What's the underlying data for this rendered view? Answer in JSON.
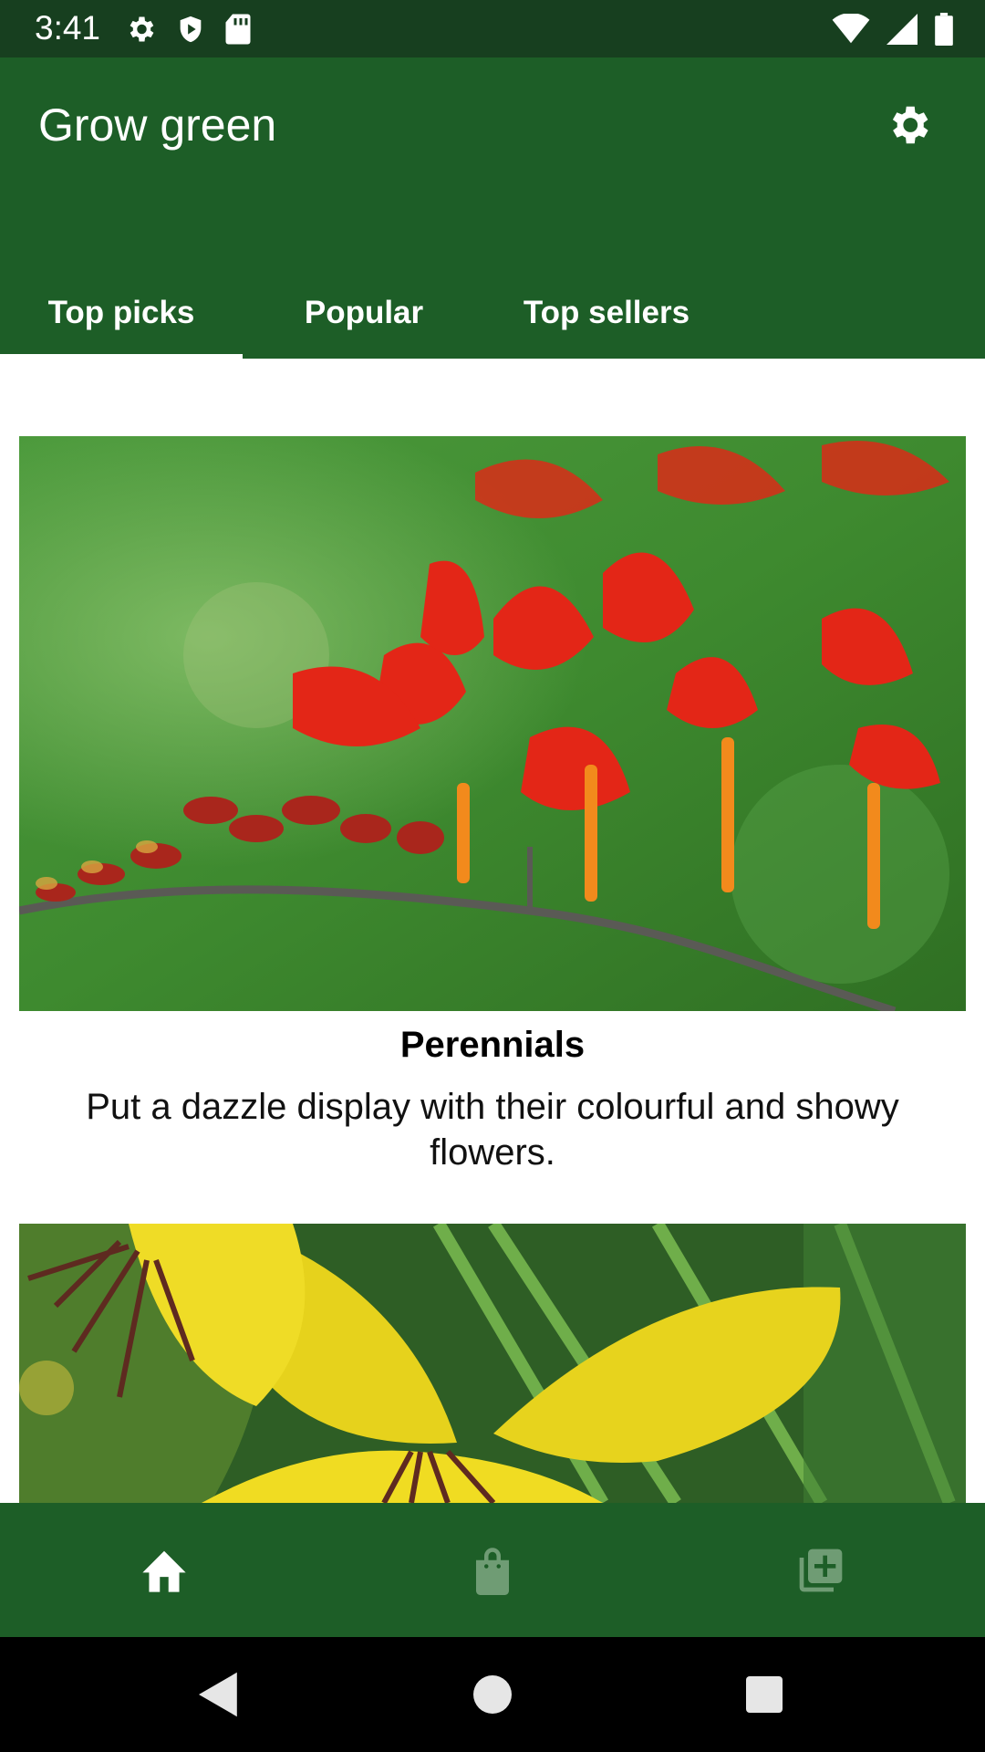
{
  "status_bar": {
    "time": "3:41",
    "left_icons": [
      "settings-icon",
      "play-protect-icon",
      "sd-card-icon"
    ],
    "right_icons": [
      "wifi-icon",
      "signal-icon",
      "battery-icon"
    ]
  },
  "app_bar": {
    "title": "Grow green",
    "settings_icon": "gear-icon",
    "background_color": "#1d5e27"
  },
  "tabs": [
    {
      "label": "Top picks",
      "selected": true
    },
    {
      "label": "Popular",
      "selected": false
    },
    {
      "label": "Top sellers",
      "selected": false
    }
  ],
  "cards": [
    {
      "image": "red-crocosmia-flowers-image",
      "title": "Perennials",
      "description": "Put a dazzle display with their colourful and showy flowers."
    },
    {
      "image": "yellow-flower-image",
      "title": "",
      "description": ""
    }
  ],
  "bottom_nav": [
    {
      "icon": "home-icon",
      "selected": true
    },
    {
      "icon": "shopping-bag-icon",
      "selected": false
    },
    {
      "icon": "library-add-icon",
      "selected": false
    }
  ],
  "system_nav": [
    "back-icon",
    "home-circle-icon",
    "recents-icon"
  ],
  "colors": {
    "status_bar": "#173f1f",
    "primary": "#1d5e27",
    "nav_inactive": "#6f9c74"
  }
}
